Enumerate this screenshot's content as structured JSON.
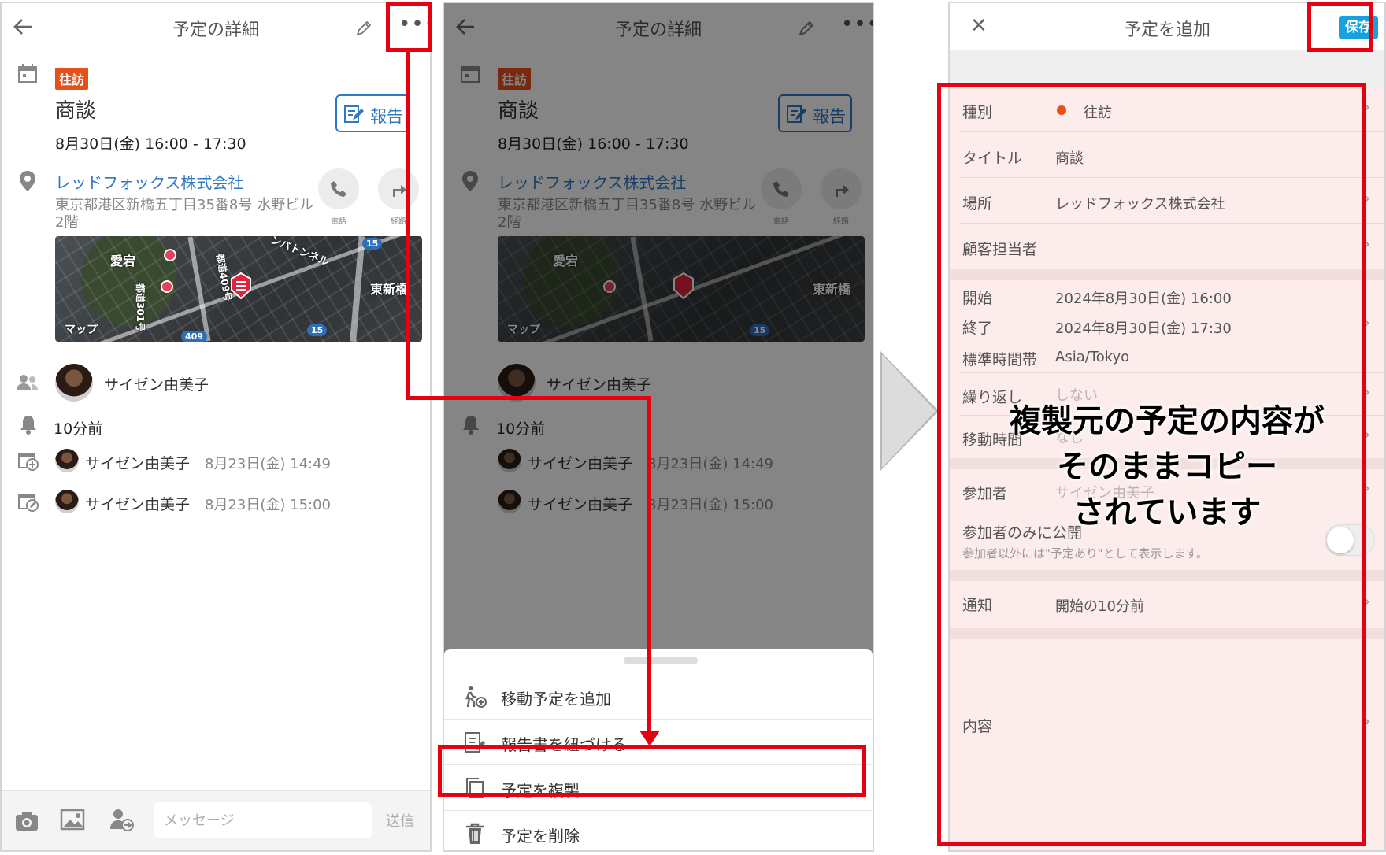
{
  "detail": {
    "header_title": "予定の詳細",
    "category_badge": "往訪",
    "title": "商談",
    "datetime": "8月30日(金) 16:00 - 17:30",
    "report_label": "報告",
    "company": "レッドフォックス株式会社",
    "address": "東京都港区新橋五丁目35番8号 水野ビル2階",
    "call_caption": "電話",
    "route_caption": "経路",
    "map_labels": {
      "atago": "愛宕",
      "higashi_shinbashi": "東新橋",
      "tunnel": "ンパトンネル",
      "road": "都道409号",
      "road2": "都道301号",
      "maps": "マップ",
      "route15": "15",
      "route409": "409"
    },
    "participant": "サイゼン由美子",
    "reminder": "10分前",
    "history": [
      {
        "name": "サイゼン由美子",
        "time": "8月23日(金) 14:49"
      },
      {
        "name": "サイゼン由美子",
        "time": "8月23日(金) 15:00"
      }
    ],
    "message_placeholder": "メッセージ",
    "send_label": "送信"
  },
  "sheet": {
    "items": [
      {
        "label": "移動予定を追加"
      },
      {
        "label": "報告書を紐づける"
      },
      {
        "label": "予定を複製"
      },
      {
        "label": "予定を削除"
      }
    ]
  },
  "add": {
    "header_title": "予定を追加",
    "save_label": "保存",
    "fields": {
      "type_label": "種別",
      "type_value": "往訪",
      "title_label": "タイトル",
      "title_value": "商談",
      "place_label": "場所",
      "place_value": "レッドフォックス株式会社",
      "customer_label": "顧客担当者",
      "start_label": "開始",
      "start_value": "2024年8月30日(金) 16:00",
      "end_label": "終了",
      "end_value": "2024年8月30日(金) 17:30",
      "tz_label": "標準時間帯",
      "tz_value": "Asia/Tokyo",
      "repeat_label": "繰り返し",
      "repeat_value": "しない",
      "travel_label": "移動時間",
      "travel_value": "なし",
      "participants_label": "参加者",
      "participants_value": "サイゼン由美子",
      "private_label": "参加者のみに公開",
      "private_note": "参加者以外には\"予定あり\"として表示します。",
      "notify_label": "通知",
      "notify_value": "開始の10分前",
      "content_label": "内容"
    },
    "callout": [
      "複製元の予定の内容が",
      "そのままコピー",
      "されています"
    ]
  },
  "colors": {
    "accent_red": "#e60012",
    "link_blue": "#2f78c8",
    "badge_orange": "#e8501b",
    "save_blue": "#1aa0e0"
  }
}
